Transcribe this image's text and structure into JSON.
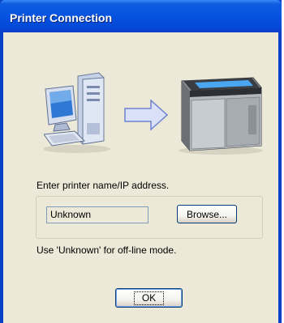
{
  "window": {
    "title": "Printer Connection"
  },
  "prompt_label": "Enter printer name/IP address.",
  "printer_field": {
    "value": "Unknown"
  },
  "browse_button": "Browse...",
  "hint": "Use 'Unknown' for off-line mode.",
  "ok_button": "OK",
  "icons": {
    "computer": "computer-icon",
    "arrow": "arrow-right-icon",
    "printer": "printer-icon"
  },
  "colors": {
    "titlebar": "#0553e0",
    "dialog_bg": "#ece9d8",
    "button_border": "#003c74"
  }
}
